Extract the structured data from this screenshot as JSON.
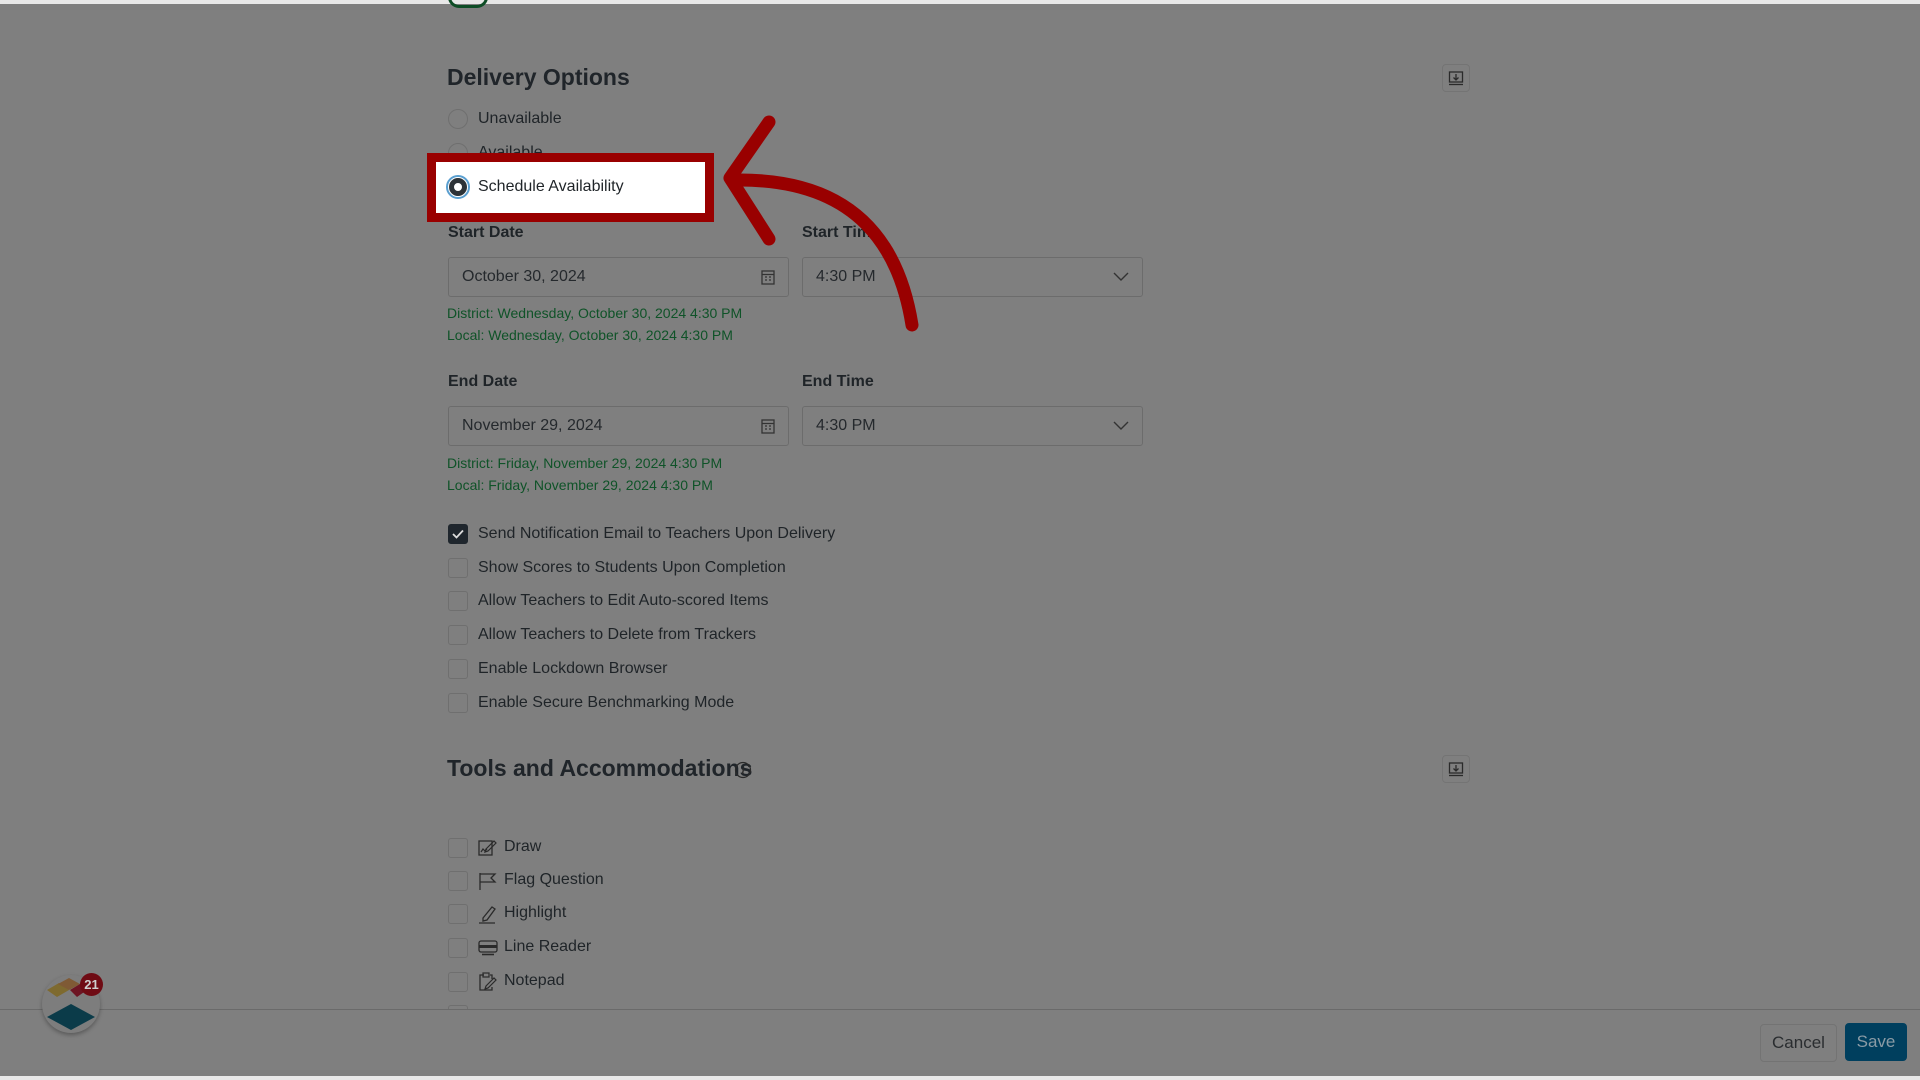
{
  "delivery_options": {
    "title": "Delivery Options",
    "radios": [
      {
        "label": "Unavailable",
        "selected": false
      },
      {
        "label": "Available",
        "selected": false
      },
      {
        "label": "Schedule Availability",
        "selected": true
      }
    ],
    "start_date": {
      "label": "Start Date",
      "value": "October 30, 2024"
    },
    "start_time": {
      "label": "Start Time",
      "value": "4:30 PM"
    },
    "start_district": "District: Wednesday, October 30, 2024 4:30 PM",
    "start_local": "Local: Wednesday, October 30, 2024 4:30 PM",
    "end_date": {
      "label": "End Date",
      "value": "November 29, 2024"
    },
    "end_time": {
      "label": "End Time",
      "value": "4:30 PM"
    },
    "end_district": "District: Friday, November 29, 2024 4:30 PM",
    "end_local": "Local: Friday, November 29, 2024 4:30 PM",
    "checkboxes": [
      {
        "label": "Send Notification Email to Teachers Upon Delivery",
        "checked": true
      },
      {
        "label": "Show Scores to Students Upon Completion",
        "checked": false
      },
      {
        "label": "Allow Teachers to Edit Auto-scored Items",
        "checked": false
      },
      {
        "label": "Allow Teachers to Delete from Trackers",
        "checked": false
      },
      {
        "label": "Enable Lockdown Browser",
        "checked": false
      },
      {
        "label": "Enable Secure Benchmarking Mode",
        "checked": false
      }
    ]
  },
  "tools": {
    "title": "Tools and Accommodations",
    "items": [
      {
        "label": "Draw",
        "icon": "draw-icon",
        "checked": false
      },
      {
        "label": "Flag Question",
        "icon": "flag-icon",
        "checked": false
      },
      {
        "label": "Highlight",
        "icon": "highlighter-icon",
        "checked": false
      },
      {
        "label": "Line Reader",
        "icon": "line-reader-icon",
        "checked": false
      },
      {
        "label": "Notepad",
        "icon": "notepad-icon",
        "checked": false
      }
    ]
  },
  "footer": {
    "cancel": "Cancel",
    "save": "Save"
  },
  "notification_badge": "21",
  "colors": {
    "annotation": "#990000",
    "save": "#003f5e",
    "green_text": "#0f5328"
  }
}
